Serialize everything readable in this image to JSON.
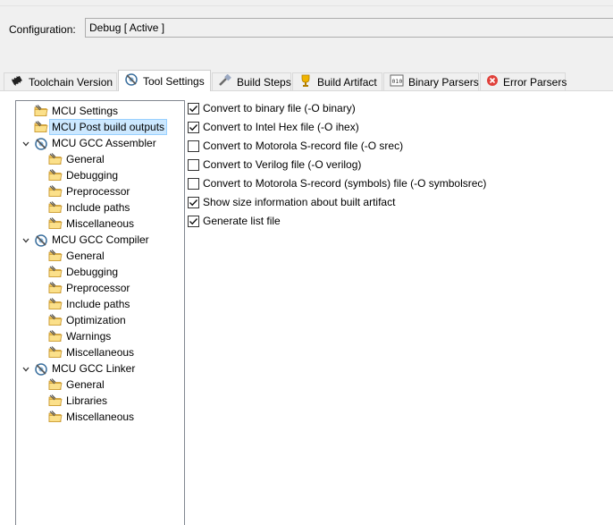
{
  "config": {
    "label": "Configuration:",
    "value": "Debug  [ Active ]"
  },
  "tabs": [
    {
      "label": "Toolchain  Version",
      "icon": "chip-icon",
      "active": false
    },
    {
      "label": "Tool Settings",
      "icon": "gear-tool-icon",
      "active": true
    },
    {
      "label": "Build Steps",
      "icon": "build-steps-icon",
      "active": false
    },
    {
      "label": "Build Artifact",
      "icon": "trophy-icon",
      "active": false
    },
    {
      "label": "Binary Parsers",
      "icon": "binary-icon",
      "active": false
    },
    {
      "label": "Error Parsers",
      "icon": "error-icon",
      "active": false
    }
  ],
  "tree": {
    "items": [
      {
        "label": "MCU Settings",
        "type": "folder"
      },
      {
        "label": "MCU Post build outputs",
        "type": "folder",
        "selected": true
      },
      {
        "label": "MCU GCC Assembler",
        "type": "tool",
        "expanded": true
      },
      {
        "label": "General",
        "type": "folder"
      },
      {
        "label": "Debugging",
        "type": "folder"
      },
      {
        "label": "Preprocessor",
        "type": "folder"
      },
      {
        "label": "Include paths",
        "type": "folder"
      },
      {
        "label": "Miscellaneous",
        "type": "folder"
      },
      {
        "label": "MCU GCC Compiler",
        "type": "tool",
        "expanded": true
      },
      {
        "label": "General",
        "type": "folder"
      },
      {
        "label": "Debugging",
        "type": "folder"
      },
      {
        "label": "Preprocessor",
        "type": "folder"
      },
      {
        "label": "Include paths",
        "type": "folder"
      },
      {
        "label": "Optimization",
        "type": "folder"
      },
      {
        "label": "Warnings",
        "type": "folder"
      },
      {
        "label": "Miscellaneous",
        "type": "folder"
      },
      {
        "label": "MCU GCC Linker",
        "type": "tool",
        "expanded": true
      },
      {
        "label": "General",
        "type": "folder"
      },
      {
        "label": "Libraries",
        "type": "folder"
      },
      {
        "label": "Miscellaneous",
        "type": "folder"
      }
    ]
  },
  "options": [
    {
      "label": "Convert to binary file (-O binary)",
      "checked": true
    },
    {
      "label": "Convert to Intel Hex file (-O ihex)",
      "checked": true
    },
    {
      "label": "Convert to Motorola S-record file (-O srec)",
      "checked": false
    },
    {
      "label": "Convert to Verilog file (-O verilog)",
      "checked": false
    },
    {
      "label": "Convert to Motorola S-record (symbols) file (-O symbolsrec)",
      "checked": false
    },
    {
      "label": "Show size information about built artifact",
      "checked": true
    },
    {
      "label": "Generate list file",
      "checked": true
    }
  ],
  "colors": {
    "selection": "#cce8ff",
    "panel": "#f0f0f0",
    "folder": "#f2c55c"
  }
}
